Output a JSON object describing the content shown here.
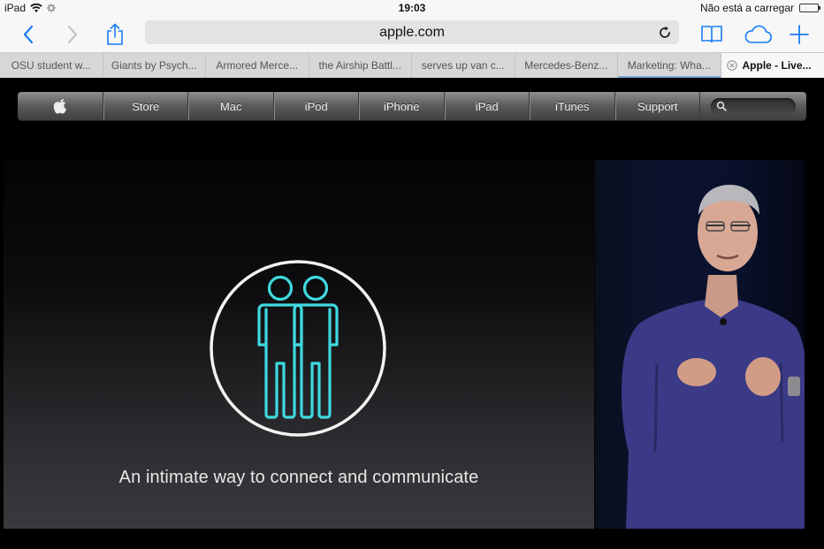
{
  "status_bar": {
    "device": "iPad",
    "time": "19:03",
    "charging": "Não está a carregar"
  },
  "toolbar": {
    "address": "apple.com"
  },
  "tabs": [
    {
      "label": "OSU student w..."
    },
    {
      "label": "Giants by Psych..."
    },
    {
      "label": "Armored Merce..."
    },
    {
      "label": "the Airship Battl..."
    },
    {
      "label": "serves up van c..."
    },
    {
      "label": "Mercedes-Benz..."
    },
    {
      "label": "Marketing: Wha..."
    },
    {
      "label": "Apple - Live..."
    }
  ],
  "globalnav": {
    "items": [
      "Store",
      "Mac",
      "iPod",
      "iPhone",
      "iPad",
      "iTunes",
      "Support"
    ]
  },
  "slide": {
    "caption": "An intimate way to connect and communicate",
    "icon_color": "#3fd9e0"
  },
  "colors": {
    "accent": "#1a7cf5"
  }
}
